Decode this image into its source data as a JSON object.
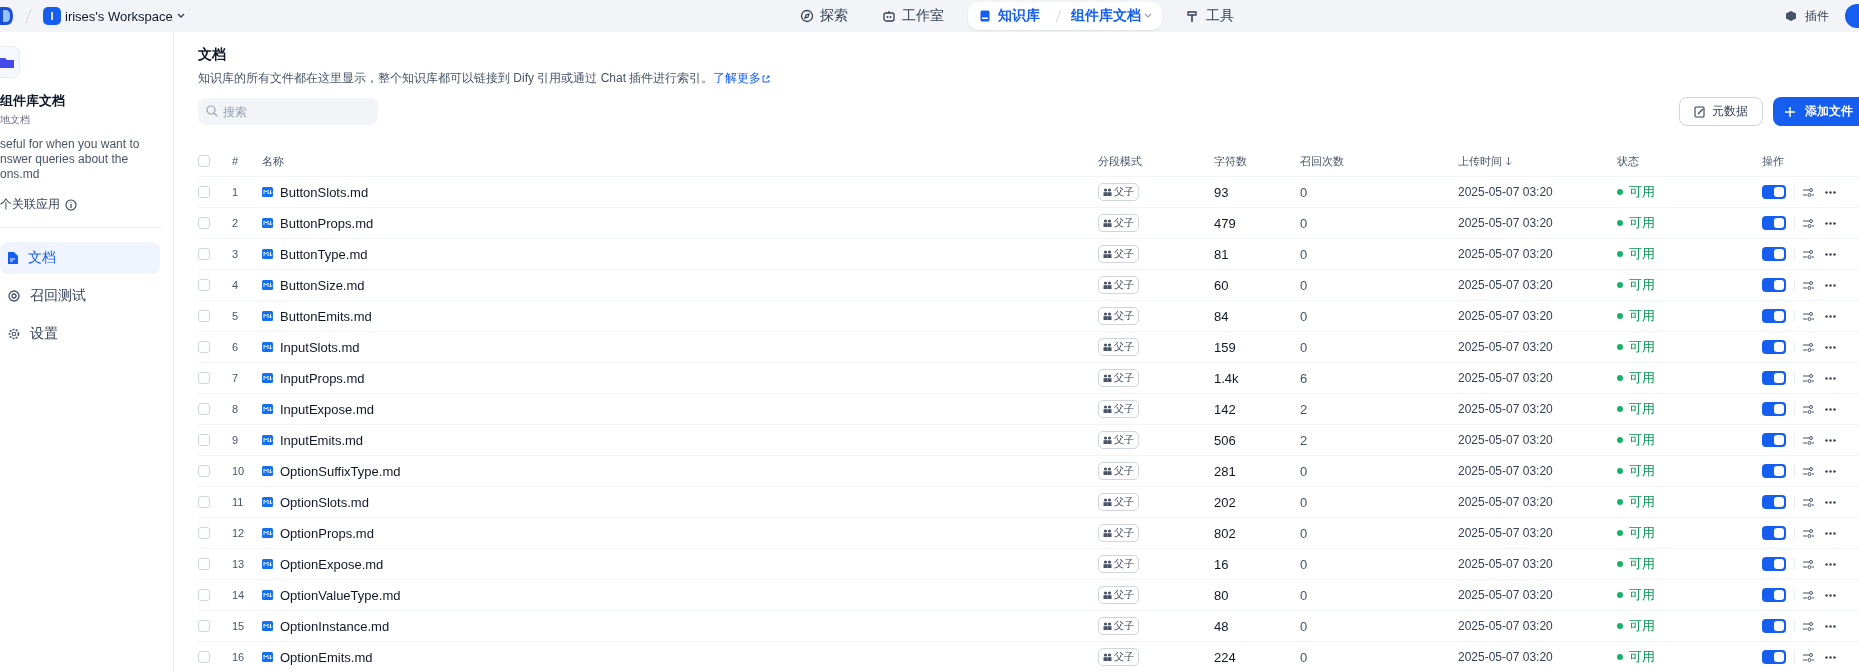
{
  "top_bar": {
    "workspace": {
      "initial": "I",
      "name": "irises's Workspace"
    },
    "nav": [
      {
        "label": "探索",
        "selected": false
      },
      {
        "label": "工作室",
        "selected": false
      },
      {
        "label": "知识库",
        "selected": true,
        "current": "组件库文档"
      },
      {
        "label": "工具",
        "selected": false
      }
    ],
    "plugins": "插件"
  },
  "sidebar": {
    "title": "组件库文档",
    "subtitle": "地文档",
    "description_lines": [
      "seful for when you want to",
      "nswer queries about the",
      "ons.md"
    ],
    "linked_apps": "个关联应用",
    "items": [
      {
        "label": "文档",
        "selected": true
      },
      {
        "label": "召回测试",
        "selected": false
      },
      {
        "label": "设置",
        "selected": false
      }
    ]
  },
  "main": {
    "title": "文档",
    "description": "知识库的所有文件都在这里显示，整个知识库都可以链接到 Dify 引用或通过 Chat 插件进行索引。",
    "learn_more": "了解更多",
    "search": {
      "placeholder": "搜索"
    },
    "buttons": [
      "元数据",
      "添加文件"
    ]
  },
  "table": {
    "select_all_checked": false,
    "columns": [
      "#",
      "名称",
      "分段模式",
      "字符数",
      "召回次数",
      "上传时间",
      "状态",
      "操作"
    ],
    "rows": [
      {
        "index": "1",
        "name": "ButtonSlots.md",
        "mode": "父子",
        "chars": "93",
        "recalls": "0",
        "uploaded": "2025-05-07 03:20",
        "status": "可用",
        "enabled": true,
        "checked": false
      },
      {
        "index": "2",
        "name": "ButtonProps.md",
        "mode": "父子",
        "chars": "479",
        "recalls": "0",
        "uploaded": "2025-05-07 03:20",
        "status": "可用",
        "enabled": true,
        "checked": false
      },
      {
        "index": "3",
        "name": "ButtonType.md",
        "mode": "父子",
        "chars": "81",
        "recalls": "0",
        "uploaded": "2025-05-07 03:20",
        "status": "可用",
        "enabled": true,
        "checked": false
      },
      {
        "index": "4",
        "name": "ButtonSize.md",
        "mode": "父子",
        "chars": "60",
        "recalls": "0",
        "uploaded": "2025-05-07 03:20",
        "status": "可用",
        "enabled": true,
        "checked": false
      },
      {
        "index": "5",
        "name": "ButtonEmits.md",
        "mode": "父子",
        "chars": "84",
        "recalls": "0",
        "uploaded": "2025-05-07 03:20",
        "status": "可用",
        "enabled": true,
        "checked": false
      },
      {
        "index": "6",
        "name": "InputSlots.md",
        "mode": "父子",
        "chars": "159",
        "recalls": "0",
        "uploaded": "2025-05-07 03:20",
        "status": "可用",
        "enabled": true,
        "checked": false
      },
      {
        "index": "7",
        "name": "InputProps.md",
        "mode": "父子",
        "chars": "1.4k",
        "recalls": "6",
        "uploaded": "2025-05-07 03:20",
        "status": "可用",
        "enabled": true,
        "checked": false
      },
      {
        "index": "8",
        "name": "InputExpose.md",
        "mode": "父子",
        "chars": "142",
        "recalls": "2",
        "uploaded": "2025-05-07 03:20",
        "status": "可用",
        "enabled": true,
        "checked": false
      },
      {
        "index": "9",
        "name": "InputEmits.md",
        "mode": "父子",
        "chars": "506",
        "recalls": "2",
        "uploaded": "2025-05-07 03:20",
        "status": "可用",
        "enabled": true,
        "checked": false
      },
      {
        "index": "10",
        "name": "OptionSuffixType.md",
        "mode": "父子",
        "chars": "281",
        "recalls": "0",
        "uploaded": "2025-05-07 03:20",
        "status": "可用",
        "enabled": true,
        "checked": false
      },
      {
        "index": "11",
        "name": "OptionSlots.md",
        "mode": "父子",
        "chars": "202",
        "recalls": "0",
        "uploaded": "2025-05-07 03:20",
        "status": "可用",
        "enabled": true,
        "checked": false
      },
      {
        "index": "12",
        "name": "OptionProps.md",
        "mode": "父子",
        "chars": "802",
        "recalls": "0",
        "uploaded": "2025-05-07 03:20",
        "status": "可用",
        "enabled": true,
        "checked": false
      },
      {
        "index": "13",
        "name": "OptionExpose.md",
        "mode": "父子",
        "chars": "16",
        "recalls": "0",
        "uploaded": "2025-05-07 03:20",
        "status": "可用",
        "enabled": true,
        "checked": false
      },
      {
        "index": "14",
        "name": "OptionValueType.md",
        "mode": "父子",
        "chars": "80",
        "recalls": "0",
        "uploaded": "2025-05-07 03:20",
        "status": "可用",
        "enabled": true,
        "checked": false
      },
      {
        "index": "15",
        "name": "OptionInstance.md",
        "mode": "父子",
        "chars": "48",
        "recalls": "0",
        "uploaded": "2025-05-07 03:20",
        "status": "可用",
        "enabled": true,
        "checked": false
      },
      {
        "index": "16",
        "name": "OptionEmits.md",
        "mode": "父子",
        "chars": "224",
        "recalls": "0",
        "uploaded": "2025-05-07 03:20",
        "status": "可用",
        "enabled": true,
        "checked": false
      }
    ]
  }
}
